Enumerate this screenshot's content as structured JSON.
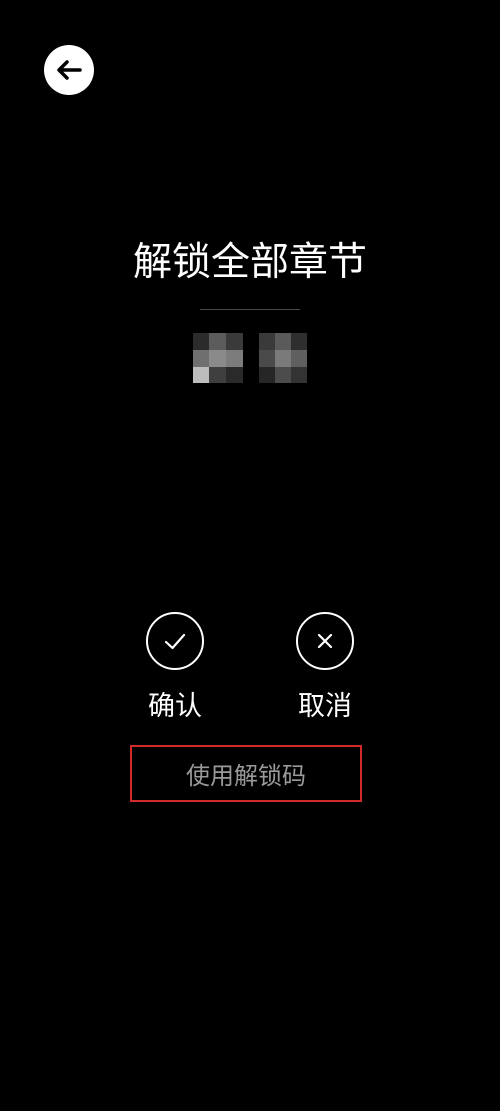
{
  "header": {
    "back_icon": "arrow-left-icon"
  },
  "main": {
    "title": "解锁全部章节"
  },
  "actions": {
    "confirm": {
      "label": "确认",
      "icon": "check-icon"
    },
    "cancel": {
      "label": "取消",
      "icon": "close-icon"
    }
  },
  "unlock_code": {
    "label": "使用解锁码",
    "border_color": "#d12a2a"
  }
}
